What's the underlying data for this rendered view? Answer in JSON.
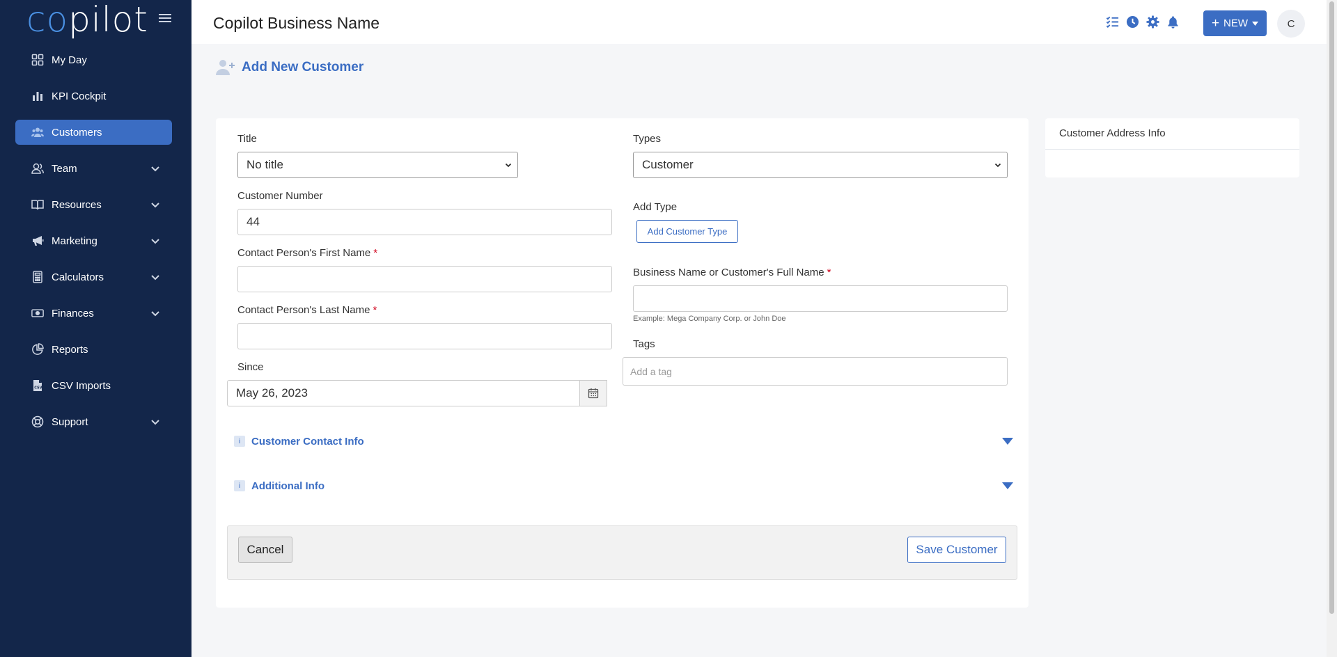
{
  "sidebar": {
    "logo": {
      "co": "co",
      "rest": "pilot"
    },
    "items": [
      {
        "label": "My Day",
        "icon": "grid-icon",
        "expandable": false
      },
      {
        "label": "KPI Cockpit",
        "icon": "bar-chart-icon",
        "expandable": false
      },
      {
        "label": "Customers",
        "icon": "users-icon",
        "expandable": false,
        "active": true
      },
      {
        "label": "Team",
        "icon": "user-group-icon",
        "expandable": true
      },
      {
        "label": "Resources",
        "icon": "book-icon",
        "expandable": true
      },
      {
        "label": "Marketing",
        "icon": "megaphone-icon",
        "expandable": true
      },
      {
        "label": "Calculators",
        "icon": "calculator-icon",
        "expandable": true
      },
      {
        "label": "Finances",
        "icon": "money-icon",
        "expandable": true
      },
      {
        "label": "Reports",
        "icon": "pie-chart-icon",
        "expandable": false
      },
      {
        "label": "CSV Imports",
        "icon": "csv-file-icon",
        "expandable": false
      },
      {
        "label": "Support",
        "icon": "lifebuoy-icon",
        "expandable": true
      }
    ]
  },
  "header": {
    "title": "Copilot Business Name",
    "new_button": "NEW",
    "avatar_initial": "C"
  },
  "page": {
    "heading": "Add New Customer"
  },
  "form": {
    "title_label": "Title",
    "title_value": "No title",
    "customer_number_label": "Customer Number",
    "customer_number_value": "44",
    "first_name_label": "Contact Person's First Name",
    "last_name_label": "Contact Person's Last Name",
    "since_label": "Since",
    "since_value": "May 26, 2023",
    "types_label": "Types",
    "types_value": "Customer",
    "add_type_label": "Add Type",
    "add_type_button": "Add Customer Type",
    "business_name_label": "Business Name or Customer's Full Name",
    "business_name_hint": "Example: Mega Company Corp. or John Doe",
    "tags_label": "Tags",
    "tags_placeholder": "Add a tag",
    "required_mark": "*",
    "sections": [
      {
        "title": "Customer Contact Info"
      },
      {
        "title": "Additional Info"
      }
    ],
    "cancel_button": "Cancel",
    "save_button": "Save Customer"
  },
  "address_panel": {
    "title": "Customer Address Info"
  },
  "colors": {
    "sidebar_bg": "#13264a",
    "accent": "#3b6dc3",
    "required": "#d0021b"
  }
}
